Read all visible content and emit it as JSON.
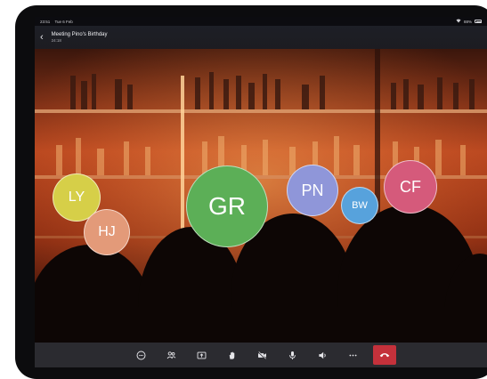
{
  "status_bar": {
    "time": "23:51",
    "date": "Tue 6 Feb",
    "battery": "88%"
  },
  "header": {
    "title": "Meeting Pino's Birthday",
    "duration": "24:18"
  },
  "participants": [
    {
      "initials": "LY",
      "color": "#d6cf48"
    },
    {
      "initials": "HJ",
      "color": "#e39a79"
    },
    {
      "initials": "GR",
      "color": "#5caf57"
    },
    {
      "initials": "PN",
      "color": "#8f96d9"
    },
    {
      "initials": "BW",
      "color": "#57a2dc"
    },
    {
      "initials": "CF",
      "color": "#d55a7b"
    }
  ],
  "controls": [
    {
      "icon": "chat-icon"
    },
    {
      "icon": "participants-icon"
    },
    {
      "icon": "share-screen-icon"
    },
    {
      "icon": "raise-hand-icon"
    },
    {
      "icon": "camera-icon"
    },
    {
      "icon": "microphone-icon"
    },
    {
      "icon": "speaker-icon"
    },
    {
      "icon": "more-icon"
    },
    {
      "icon": "hang-up-icon",
      "color": "#c4313b"
    }
  ]
}
